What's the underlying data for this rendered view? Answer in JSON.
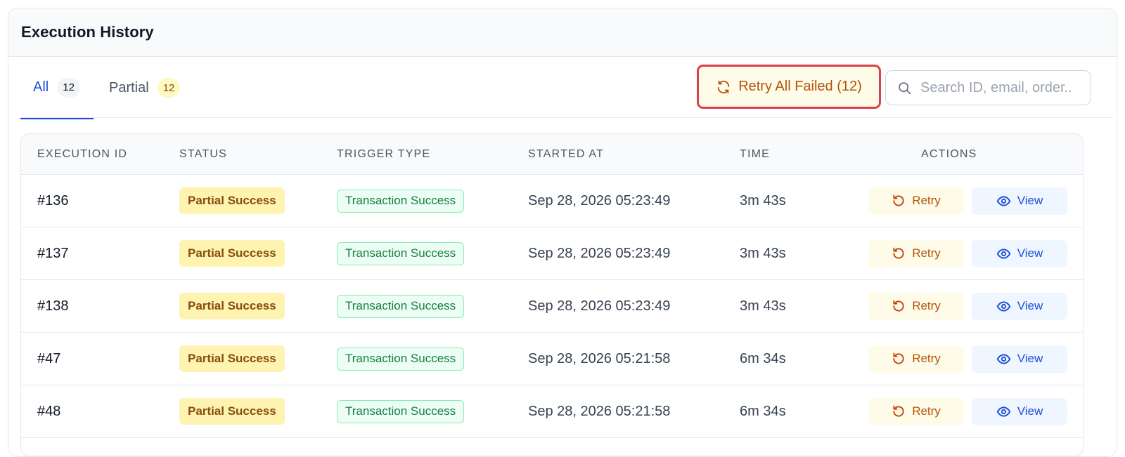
{
  "header": {
    "title": "Execution History"
  },
  "tabs": [
    {
      "label": "All",
      "count": "12"
    },
    {
      "label": "Partial",
      "count": "12"
    }
  ],
  "toolbar": {
    "retry_all_label": "Retry All Failed (12)",
    "search_placeholder": "Search ID, email, order..",
    "search_value": ""
  },
  "table": {
    "columns": [
      "EXECUTION ID",
      "STATUS",
      "TRIGGER TYPE",
      "STARTED AT",
      "TIME",
      "ACTIONS"
    ],
    "rows": [
      {
        "id": "#136",
        "status": "Partial Success",
        "trigger": "Transaction Success",
        "started": "Sep 28, 2026 05:23:49",
        "time": "3m 43s",
        "retry": "Retry",
        "view": "View"
      },
      {
        "id": "#137",
        "status": "Partial Success",
        "trigger": "Transaction Success",
        "started": "Sep 28, 2026 05:23:49",
        "time": "3m 43s",
        "retry": "Retry",
        "view": "View"
      },
      {
        "id": "#138",
        "status": "Partial Success",
        "trigger": "Transaction Success",
        "started": "Sep 28, 2026 05:23:49",
        "time": "3m 43s",
        "retry": "Retry",
        "view": "View"
      },
      {
        "id": "#47",
        "status": "Partial Success",
        "trigger": "Transaction Success",
        "started": "Sep 28, 2026 05:21:58",
        "time": "6m 34s",
        "retry": "Retry",
        "view": "View"
      },
      {
        "id": "#48",
        "status": "Partial Success",
        "trigger": "Transaction Success",
        "started": "Sep 28, 2026 05:21:58",
        "time": "6m 34s",
        "retry": "Retry",
        "view": "View"
      }
    ]
  },
  "colors": {
    "accent_blue": "#1d4ed8",
    "retry_orange": "#b45309",
    "highlight_red": "#d9404a",
    "status_yellow": "#fef3b0",
    "trigger_green": "#15803d"
  },
  "icons": {
    "retry_all": "refresh-icon",
    "search": "search-icon",
    "retry": "rotate-ccw-icon",
    "view": "eye-icon"
  }
}
